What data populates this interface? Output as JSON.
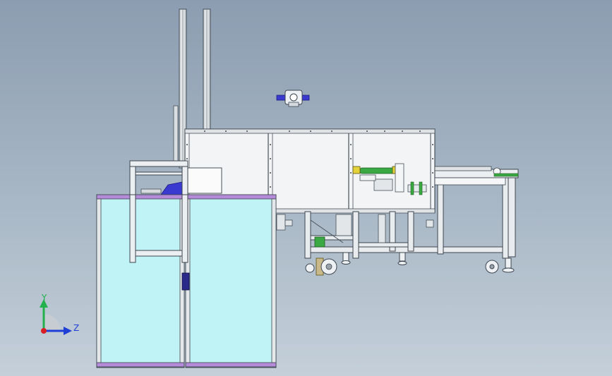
{
  "triad": {
    "y_label": "Y",
    "z_label": "Z",
    "colors": {
      "y": "#22b14c",
      "z": "#1f3fd6",
      "origin": "#d81f26"
    }
  },
  "colors": {
    "background_top": "#8c9db1",
    "background_bottom": "#c4cfd9",
    "frame": "#e9ecee",
    "frame_edge": "#45505a",
    "guard_panel": "#bff3f5",
    "guard_trim": "#b58ad8",
    "accent_blue": "#3a3ad0",
    "accent_green": "#3aa843",
    "accent_yellow": "#e3d23a"
  }
}
